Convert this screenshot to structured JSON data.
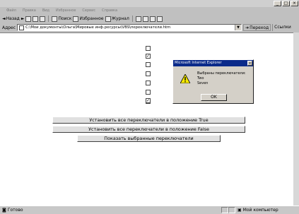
{
  "window": {
    "title": ""
  },
  "menu": [
    "Файл",
    "Правка",
    "Вид",
    "Избранное",
    "Сервис",
    "Справка"
  ],
  "toolbar": {
    "back": "Назад",
    "search": "Поиск",
    "favorites": "Избранное",
    "history": "Журнал"
  },
  "address": {
    "label": "Адрес",
    "value": "C:\\Мои документы\\Ольга\\Мировые инф.ресурсы\\VBS\\переключатели.htm",
    "go": "Переход",
    "links": "Ссылки"
  },
  "checkboxes": [
    {
      "checked": false
    },
    {
      "checked": true
    },
    {
      "checked": false
    },
    {
      "checked": false
    },
    {
      "checked": false
    },
    {
      "checked": false
    },
    {
      "checked": false
    },
    {
      "checked": true
    }
  ],
  "buttons": {
    "set_true": "Установить все переключатели в положение True",
    "set_false": "Установить все переключатели в положение False",
    "show_selected": "Показать выбранные переключатели"
  },
  "dialog": {
    "title": "Microsoft Internet Explorer",
    "lines": [
      "Выбраны переключатели:",
      "Two",
      "Seven"
    ],
    "ok": "OK"
  },
  "status": {
    "left": "Готово",
    "zone": "Мой компьютер"
  },
  "colors": {
    "dialog_title_bar": "#0a2a8a",
    "chrome": "#c0c0c0"
  }
}
